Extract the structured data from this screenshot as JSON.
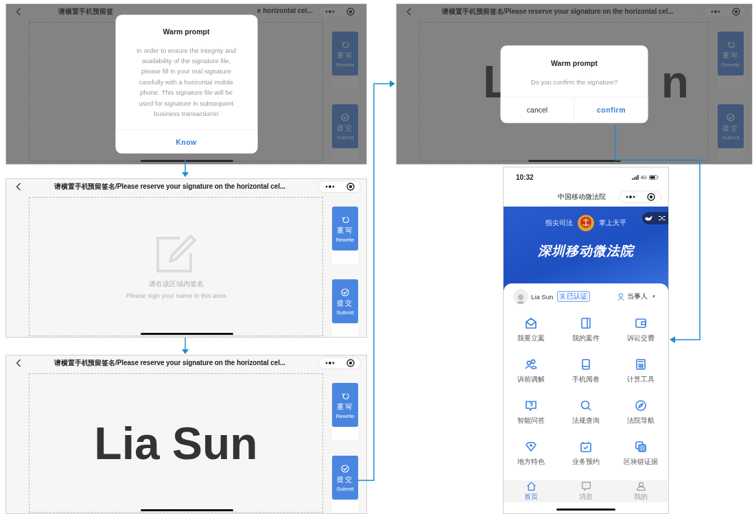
{
  "left_column": [
    {
      "title_parts": [
        "请横置手机预留签",
        "e horizontal cel..."
      ],
      "dimmed": true,
      "buttons": [
        {
          "label": "重写",
          "caption": "Rewrite"
        },
        {
          "label": "提交",
          "caption": "Submit"
        }
      ],
      "dialog": {
        "title": "Warm prompt",
        "message": "In order to ensure the integrity and availability of the signature file, please fill in your real signature carefully with a horizontal mobile phone. This signature file will be used for signature in subsequent business transactions!",
        "actions": [
          {
            "label": "Know",
            "primary": true
          }
        ]
      }
    },
    {
      "title": "请横置手机预留签名/Please reserve your signature on the horizontal cel...",
      "dimmed": false,
      "placeholder": {
        "text": "请在该区域内签名",
        "hint": "Please sign your name in this area"
      },
      "buttons": [
        {
          "label": "重写",
          "caption": "Rewrite"
        },
        {
          "label": "提交",
          "caption": "Submit"
        }
      ]
    },
    {
      "title": "请横置手机预留签名/Please reserve your signature on the horizontal cel...",
      "dimmed": false,
      "signature": "Lia Sun",
      "buttons": [
        {
          "label": "重写",
          "caption": "Rewrite"
        },
        {
          "label": "提交",
          "caption": "Submit"
        }
      ]
    }
  ],
  "right_column": {
    "screen": {
      "title": "请横置手机预留签名/Please reserve your signature on the horizontal cel...",
      "dimmed": true,
      "signature_parts": [
        "L",
        "n"
      ],
      "buttons": [
        {
          "label": "重写",
          "caption": "Rewrite"
        },
        {
          "label": "提交",
          "caption": "Submit"
        }
      ],
      "dialog": {
        "title": "Warm prompt",
        "message": "Do you confirm the signature?",
        "actions": [
          {
            "label": "cancel",
            "primary": false
          },
          {
            "label": "confirm",
            "primary": true
          }
        ]
      }
    },
    "phone": {
      "status": {
        "time": "10:32",
        "network": "4G"
      },
      "title": "中国移动微法院",
      "banner": {
        "left_slogan": "指尖司法",
        "right_slogan": "掌上天平",
        "heading": "深圳移动微法院"
      },
      "user": {
        "name": "Lia Sun",
        "badge": "已认证",
        "role": "当事人",
        "role_caret": "▼"
      },
      "services": [
        {
          "label": "我要立案"
        },
        {
          "label": "我的案件"
        },
        {
          "label": "诉讼交费"
        },
        {
          "label": "诉前调解"
        },
        {
          "label": "手机阅卷"
        },
        {
          "label": "计算工具"
        },
        {
          "label": "智能问答"
        },
        {
          "label": "法规查询"
        },
        {
          "label": "法院导航"
        },
        {
          "label": "地方特色"
        },
        {
          "label": "业务预约"
        },
        {
          "label": "区块链证据"
        }
      ],
      "tabs": [
        {
          "label": "首页",
          "selected": true
        },
        {
          "label": "消息",
          "selected": false
        },
        {
          "label": "我的",
          "selected": false
        }
      ]
    }
  }
}
